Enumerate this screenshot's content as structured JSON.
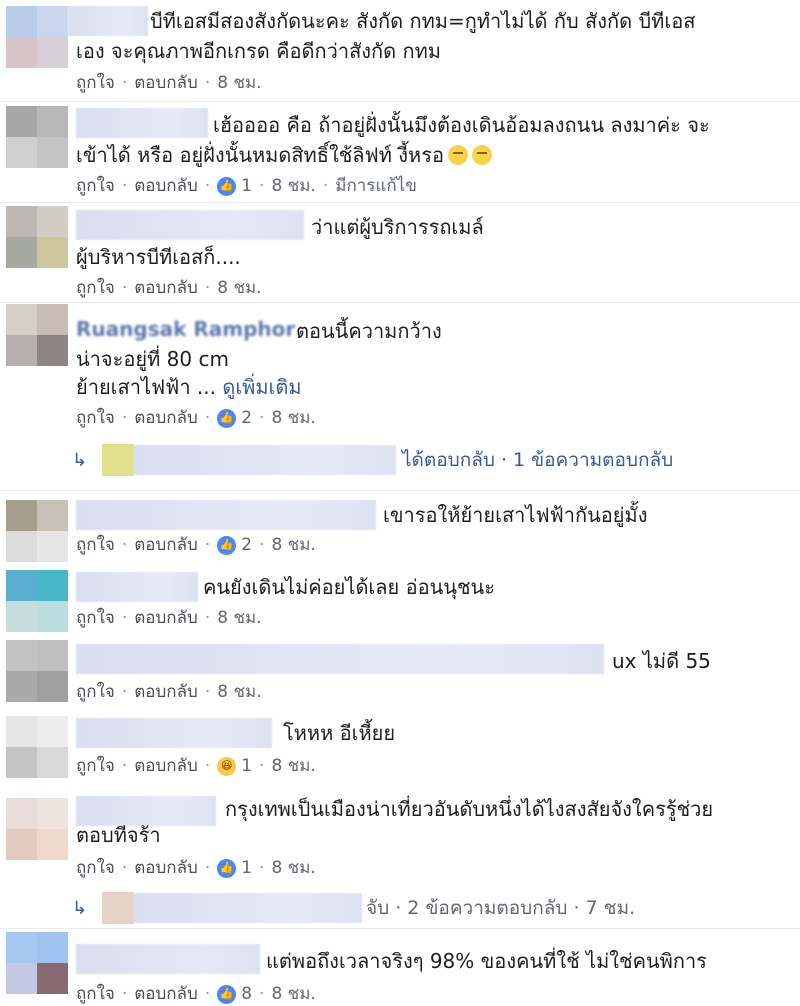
{
  "actions": {
    "like": "ถูกใจ",
    "reply": "ตอบกลับ",
    "dot": "·",
    "edited": "มีการแก้ไข",
    "see_more": "ดูเพิ่มเติม"
  },
  "comments": [
    {
      "line1": "บีทีเอสมีสองสังกัดนะคะ สังกัด กทม=กูทำไม่ได้ กับ สังกัด บีทีเอส",
      "line2": "เอง จะคุณภาพอีกเกรด คือดีกว่าสังกัด กทม",
      "time": "8 ชม."
    },
    {
      "line1": "เฮ้ออออ คือ ถ้าอยู่ฝั่งนั้นมึงต้องเดินอ้อมลงถนน ลงมาค่ะ จะ",
      "line2": "เข้าได้ หรือ อยู่ฝั่งนั้นหมดสิทธิ์ใช้ลิฟท์ งี้หรอ",
      "likes": "1",
      "time": "8 ชม."
    },
    {
      "line1": "ว่าแต่ผู้บริการรถเมล์",
      "line2": "ผู้บริหารบีทีเอสก็....",
      "time": "8 ชม."
    },
    {
      "name_partial": "Ruangsak Ramphor",
      "line1": "ตอนนี้ความกว้าง",
      "line2": "น่าจะอยู่ที่ 80 cm",
      "line3": "ย้ายเสาไฟฟ้า ...",
      "likes": "2",
      "time": "8 ชม.",
      "reply_summary": "ได้ตอบกลับ · 1 ข้อความตอบกลับ"
    },
    {
      "line1": "เขารอให้ย้ายเสาไฟฟ้ากันอยู่มั้ง",
      "likes": "2",
      "time": "8 ชม."
    },
    {
      "line1": "คนยังเดินไม่ค่อยได้เลย อ่อนนุชนะ",
      "time": "8 ชม."
    },
    {
      "line1": "ux ไม่ดี 55",
      "time": "8 ชม."
    },
    {
      "line1": "โหหห อีเหี้ยย",
      "likes": "1",
      "time": "8 ชม."
    },
    {
      "line1": "กรุงเทพเป็นเมืองน่าเที่ยวอันดับหนึ่งได้ไงสงสัยจังใครรู้ช่วย",
      "line2": "ตอบทีจร้า",
      "likes": "1",
      "time": "8 ชม.",
      "reply_summary": "จับ · 2 ข้อความตอบกลับ · 7 ชม."
    },
    {
      "line1": "แต่พอถึงเวลาจริงๆ 98% ของคนที่ใช้ ไม่ใช่คนพิการ",
      "likes": "8",
      "time": "8 ชม."
    }
  ],
  "colors": {
    "link": "#385898",
    "meta": "#606770",
    "like_blue": "#4b86f3"
  }
}
